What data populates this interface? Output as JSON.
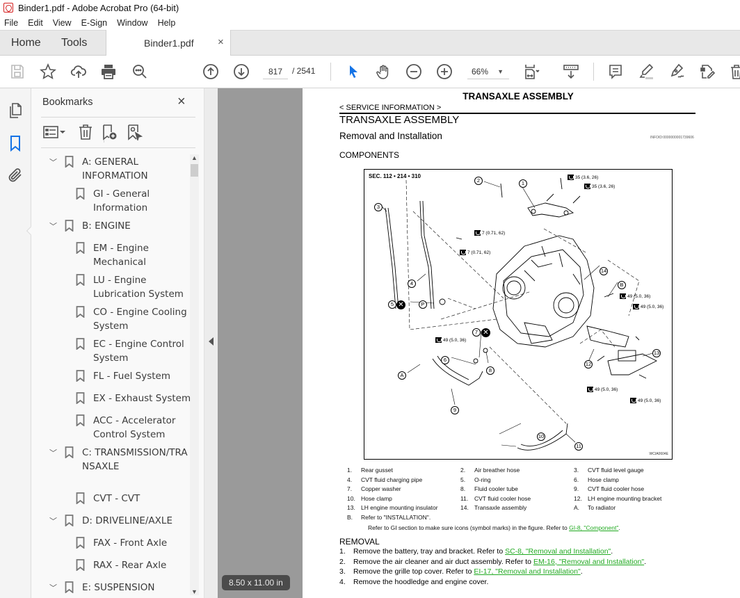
{
  "window": {
    "title": "Binder1.pdf - Adobe Acrobat Pro (64-bit)",
    "app_icon": "acrobat-icon"
  },
  "menu": [
    "File",
    "Edit",
    "View",
    "E-Sign",
    "Window",
    "Help"
  ],
  "tabs": {
    "home": "Home",
    "tools": "Tools",
    "document": "Binder1.pdf",
    "close": "×"
  },
  "toolbar": {
    "icons": [
      "save-icon",
      "bookmark-star-icon",
      "upload-cloud-icon",
      "print-icon",
      "search-zoom-icon",
      "page-up-icon",
      "page-down-icon",
      "select-pointer-icon",
      "hand-icon",
      "zoom-out-icon",
      "zoom-in-icon",
      "fit-page-icon",
      "scroll-mode-icon",
      "comment-icon",
      "highlight-icon",
      "sign-icon",
      "edit-pdf-icon",
      "delete-icon"
    ],
    "current_page": "817",
    "total_pages": "/ 2541",
    "zoom": "66%",
    "accent_color": "#1473e6"
  },
  "left_rail": {
    "icons": [
      "page-thumbnails-icon",
      "bookmarks-icon",
      "attachments-icon"
    ]
  },
  "bookmarks": {
    "title": "Bookmarks",
    "close": "×",
    "tools": [
      "options-menu-icon",
      "delete-bookmark-icon",
      "new-bookmark-icon",
      "bookmark-from-selection-icon"
    ],
    "items": [
      {
        "level": 0,
        "expanded": true,
        "label": "A: GENERAL INFORMATION"
      },
      {
        "level": 1,
        "label": "GI - General Information"
      },
      {
        "level": 0,
        "expanded": true,
        "label": "B: ENGINE"
      },
      {
        "level": 1,
        "label": "EM - Engine Mechanical"
      },
      {
        "level": 1,
        "label": "LU - Engine Lubrication System"
      },
      {
        "level": 1,
        "label": "CO - Engine Cooling System"
      },
      {
        "level": 1,
        "label": "EC - Engine Control System"
      },
      {
        "level": 1,
        "label": "FL - Fuel System"
      },
      {
        "level": 1,
        "label": "EX - Exhaust System"
      },
      {
        "level": 1,
        "label": "ACC - Accelerator Control System"
      },
      {
        "level": 0,
        "expanded": true,
        "label": "C: TRANSMISSION/TRANSAXLE"
      },
      {
        "level": 1,
        "label": "CVT - CVT"
      },
      {
        "level": 0,
        "expanded": true,
        "label": "D: DRIVELINE/AXLE"
      },
      {
        "level": 1,
        "label": "FAX - Front Axle"
      },
      {
        "level": 1,
        "label": "RAX - Rear Axle"
      },
      {
        "level": 0,
        "expanded": true,
        "label": "E: SUSPENSION"
      }
    ]
  },
  "page_size": "8.50 x 11.00 in",
  "page": {
    "header": "TRANSAXLE ASSEMBLY",
    "breadcrumb": "< SERVICE INFORMATION >",
    "h1": "TRANSAXLE ASSEMBLY",
    "h2": "Removal and Installation",
    "info_id": "INFOID:0000000001739606",
    "h3": "COMPONENTS",
    "figure": {
      "section": "SEC. 112 • 214 • 310",
      "code": "WCIA0604E",
      "callouts": [
        "1",
        "2",
        "3",
        "4",
        "5",
        "6",
        "7",
        "8",
        "9",
        "10",
        "11",
        "12",
        "13",
        "14",
        "A",
        "B",
        "P"
      ],
      "torques": {
        "t35a": "35 (3.6, 26)",
        "t35b": "35 (3.6, 26)",
        "t7a": "7 (0.71, 62)",
        "t7b": "7 (0.71, 62)",
        "t49a": "49 (5.0, 36)",
        "t49b": "49 (5.0, 36)",
        "t49c": "49 (5.0, 36)",
        "t49d": "49 (5.0, 36)",
        "t49e": "49 (5.0, 36)"
      }
    },
    "legend": [
      {
        "num": "1.",
        "text": "Rear gusset"
      },
      {
        "num": "2.",
        "text": "Air breather hose"
      },
      {
        "num": "3.",
        "text": "CVT fluid level gauge"
      },
      {
        "num": "4.",
        "text": "CVT fluid charging pipe"
      },
      {
        "num": "5.",
        "text": "O-ring"
      },
      {
        "num": "6.",
        "text": "Hose clamp"
      },
      {
        "num": "7.",
        "text": "Copper washer"
      },
      {
        "num": "8.",
        "text": "Fluid cooler tube"
      },
      {
        "num": "9.",
        "text": "CVT fluid cooler hose"
      },
      {
        "num": "10.",
        "text": "Hose clamp"
      },
      {
        "num": "11.",
        "text": "CVT fluid cooler hose"
      },
      {
        "num": "12.",
        "text": "LH engine mounting bracket"
      },
      {
        "num": "13.",
        "text": "LH engine mounting insulator"
      },
      {
        "num": "14.",
        "text": "Transaxle assembly"
      },
      {
        "num": "A.",
        "text": "To radiator"
      },
      {
        "num": "B.",
        "text": "Refer to \"INSTALLATION\"."
      }
    ],
    "refer_text": "Refer to GI section to make sure icons (symbol marks) in the figure. Refer to ",
    "refer_link": "GI-8, \"Component\"",
    "refer_end": ".",
    "link_color": "#22aa22",
    "removal_title": "REMOVAL",
    "removal_steps": [
      {
        "num": "1.",
        "text": "Remove the battery, tray and bracket. Refer to ",
        "link": "SC-8, \"Removal and Installation\"",
        "end": "."
      },
      {
        "num": "2.",
        "text": "Remove the air cleaner and air duct assembly. Refer to ",
        "link": "EM-16, \"Removal and Installation\"",
        "end": "."
      },
      {
        "num": "3.",
        "text": "Remove the grille top cover. Refer to ",
        "link": "EI-17, \"Removal and Installation\"",
        "end": "."
      },
      {
        "num": "4.",
        "text": "Remove the hoodledge and engine cover.",
        "link": "",
        "end": ""
      }
    ]
  }
}
